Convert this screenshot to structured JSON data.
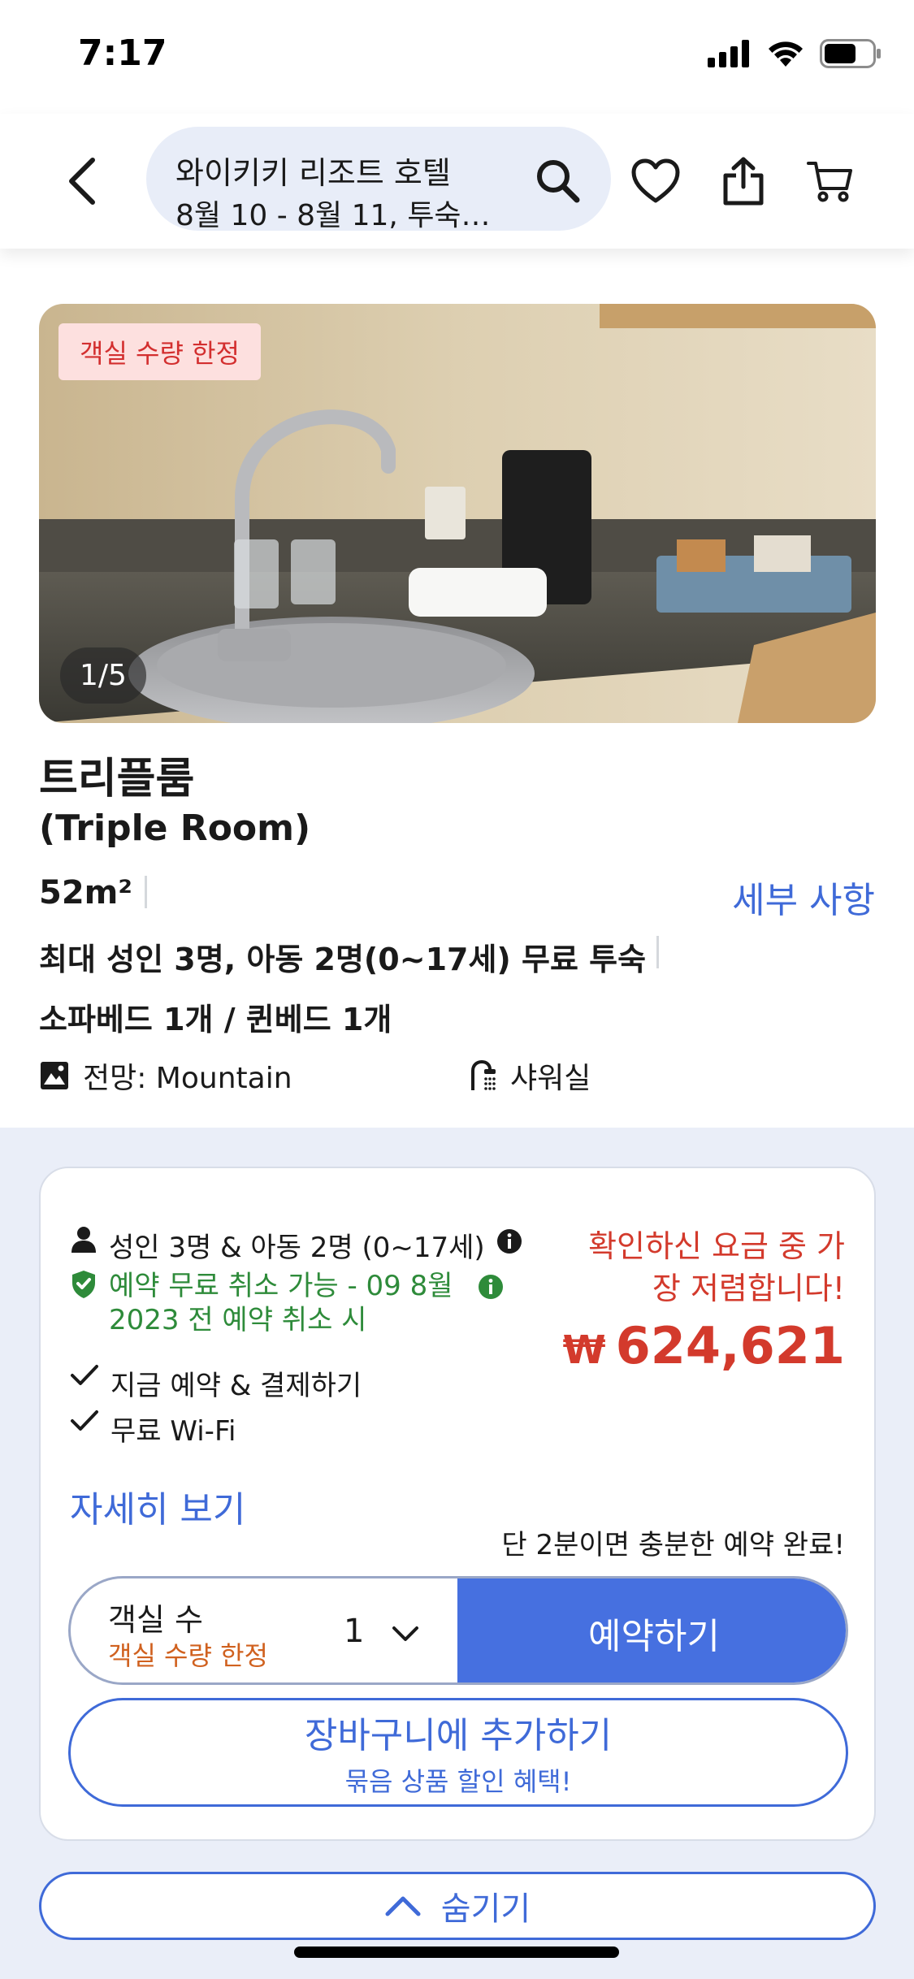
{
  "status_bar": {
    "time": "7:17"
  },
  "header": {
    "search_title": "와이키키 리조트 호텔",
    "search_subtitle": "8월 10 - 8월 11, 투숙…"
  },
  "room": {
    "photo_badge": "객실 수량 한정",
    "photo_counter": "1/5",
    "name_ko": "트리플룸",
    "name_en": "(Triple Room)",
    "size": "52m²",
    "details_link": "세부 사항",
    "occupancy": "최대 성인 3명, 아동 2명(0~17세) 무료 투숙",
    "beds": "소파베드 1개 / 퀸베드 1개",
    "view": "전망: Mountain",
    "bathroom": "샤워실"
  },
  "rate": {
    "guests": "성인 3명 & 아동 2명 (0~17세)",
    "cancel_line1": "예약 무료 취소 가능 - 09 8월",
    "cancel_line2": "2023 전 예약 취소 시",
    "pay_now": "지금 예약 & 결제하기",
    "wifi": "무료 Wi-Fi",
    "more_link": "자세히 보기",
    "price_note": "확인하신 요금 중 가장 저렴합니다!",
    "currency": "₩",
    "price": "624,621",
    "quick_note": "단 2분이면 충분한 예약 완료!",
    "room_count_label": "객실 수",
    "room_count_sub": "객실 수량 한정",
    "quantity": "1",
    "book_button": "예약하기",
    "cart_button": "장바구니에 추가하기",
    "cart_sub": "묶음 상품 할인 혜택!"
  },
  "hide_button": "숨기기",
  "colors": {
    "accent": "#3f6ad8",
    "book_button": "#4670e0",
    "price_red": "#d33a2c",
    "cancel_green": "#2e8b3a",
    "limited_orange": "#d0611f",
    "lower_bg": "#eaeef8"
  }
}
